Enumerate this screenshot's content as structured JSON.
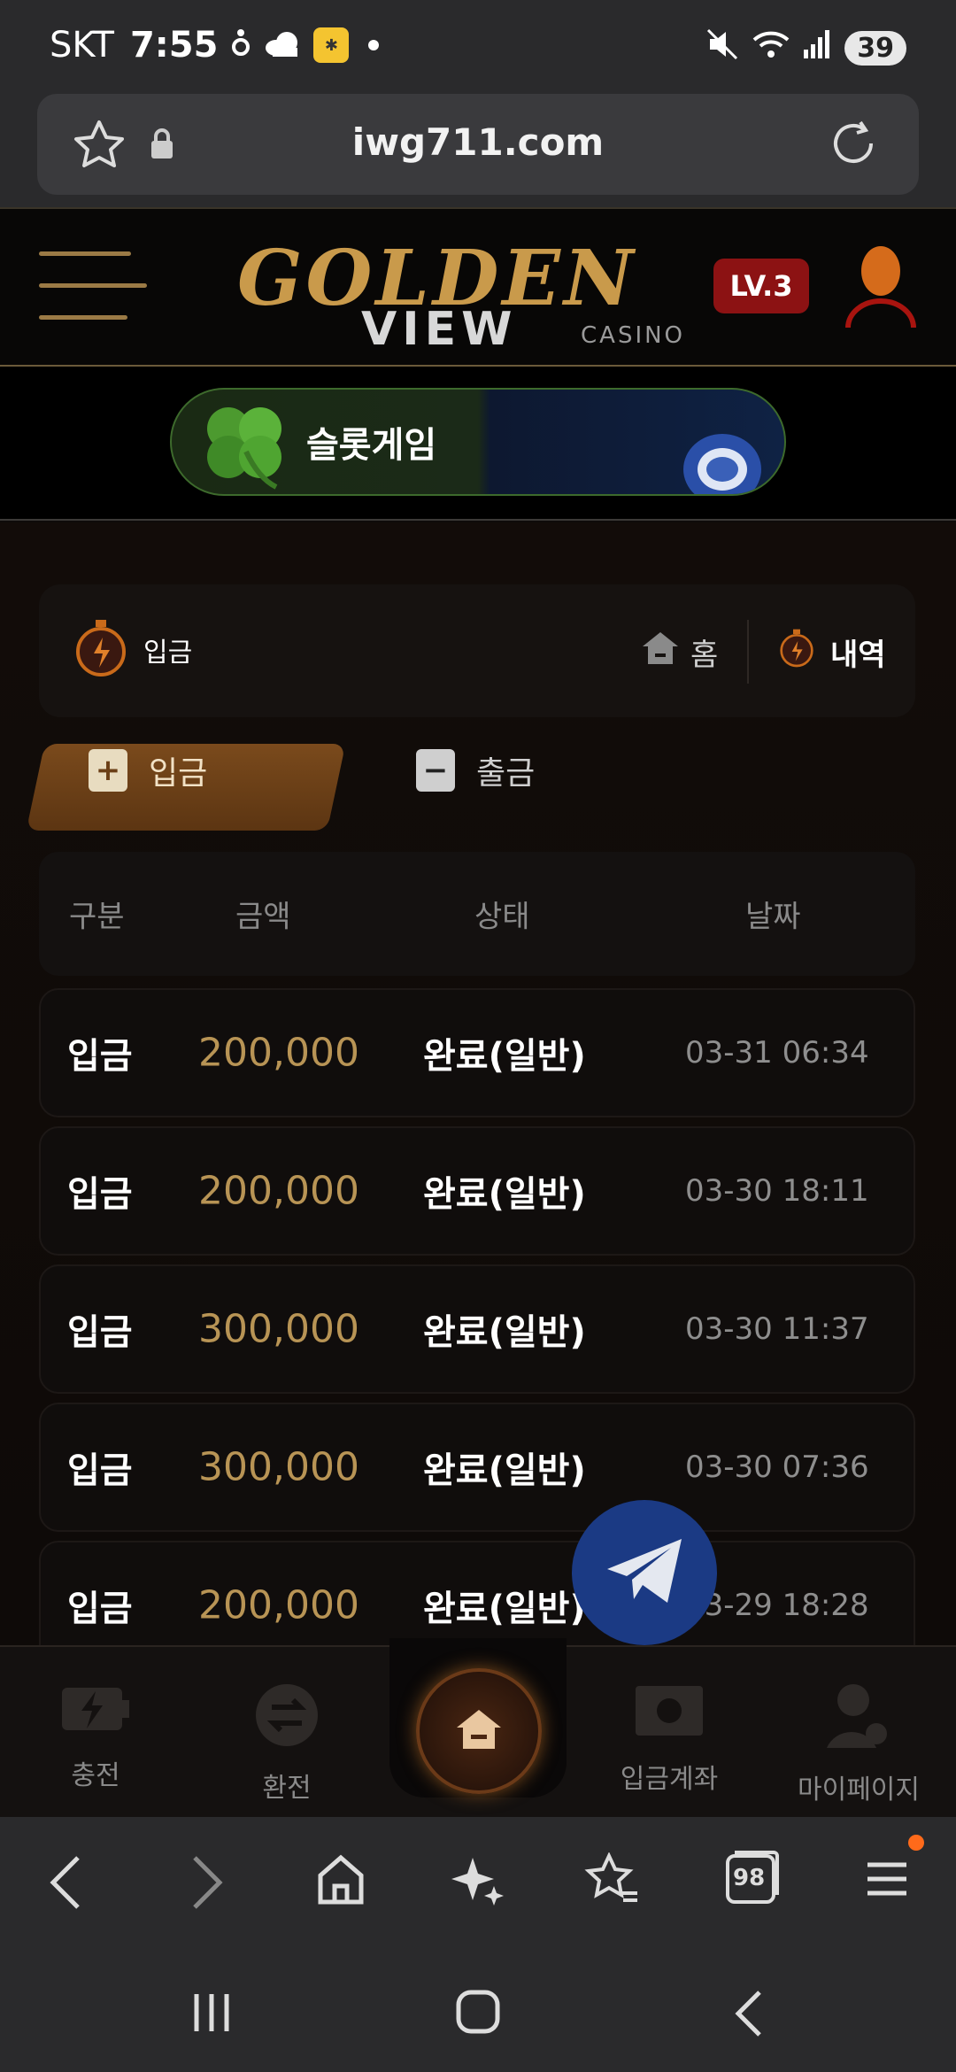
{
  "status_bar": {
    "carrier": "SKT",
    "time": "7:55",
    "battery": "39"
  },
  "browser": {
    "url": "iwg711.com",
    "tab_count": "98"
  },
  "header": {
    "logo_word1": "GOLDEN",
    "logo_word2": "VIEW",
    "logo_word3": "CASINO",
    "level_badge": "LV.3"
  },
  "banner": {
    "label": "슬롯게임"
  },
  "page": {
    "title": "입금",
    "home_link": "홈",
    "history_link": "내역"
  },
  "tabs": {
    "deposit": "입금",
    "withdraw": "출금"
  },
  "table": {
    "headers": [
      "구분",
      "금액",
      "상태",
      "날짜"
    ],
    "rows": [
      {
        "type": "입금",
        "amount": "200,000",
        "status": "완료(일반)",
        "date": "03-31 06:34"
      },
      {
        "type": "입금",
        "amount": "200,000",
        "status": "완료(일반)",
        "date": "03-30 18:11"
      },
      {
        "type": "입금",
        "amount": "300,000",
        "status": "완료(일반)",
        "date": "03-30 11:37"
      },
      {
        "type": "입금",
        "amount": "300,000",
        "status": "완료(일반)",
        "date": "03-30 07:36"
      },
      {
        "type": "입금",
        "amount": "200,000",
        "status": "완료(일반)",
        "date": "03-29 18:28"
      }
    ]
  },
  "bottom_nav": {
    "charge": "충전",
    "exchange": "환전",
    "deposit_account": "입금계좌",
    "mypage": "마이페이지"
  },
  "colors": {
    "accent_gold": "#b89455",
    "badge_red": "#8c1213",
    "tab_brown": "#6b3f16",
    "telegram_blue": "#1b3a84"
  }
}
